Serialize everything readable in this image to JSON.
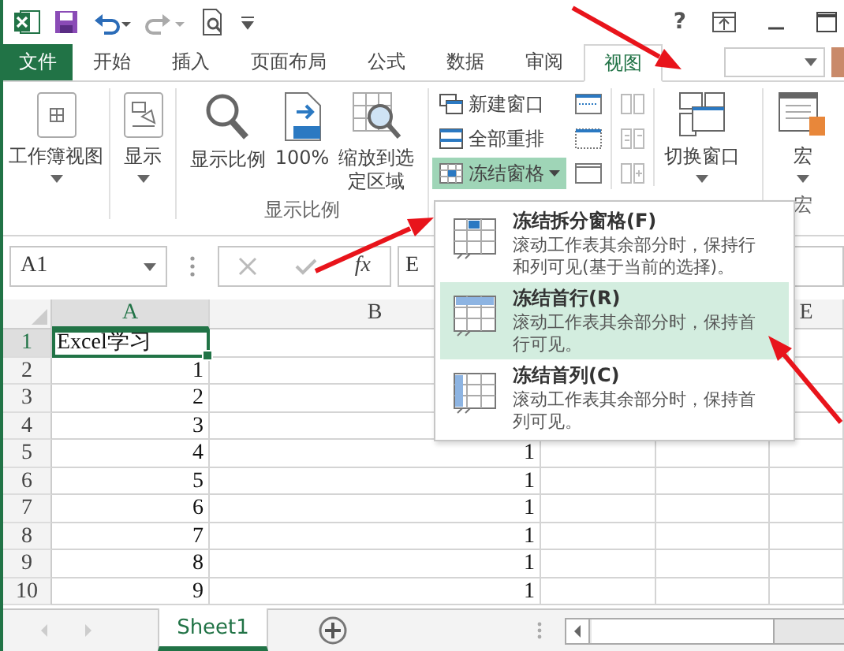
{
  "title_bar": {
    "help": "?"
  },
  "tabs": [
    {
      "label": "文件",
      "kind": "file",
      "selected": false
    },
    {
      "label": "开始",
      "kind": "tab",
      "selected": false
    },
    {
      "label": "插入",
      "kind": "tab",
      "selected": false
    },
    {
      "label": "页面布局",
      "kind": "tab",
      "selected": false
    },
    {
      "label": "公式",
      "kind": "tab",
      "selected": false
    },
    {
      "label": "数据",
      "kind": "tab",
      "selected": false
    },
    {
      "label": "审阅",
      "kind": "tab",
      "selected": false
    },
    {
      "label": "视图",
      "kind": "tab",
      "selected": true
    }
  ],
  "ribbon": {
    "workbook_views": "工作簿视图",
    "show": "显示",
    "zoom_group": {
      "label": "显示比例",
      "buttons": [
        "显示比例",
        "100%",
        "缩放到选定区域"
      ]
    },
    "window_group": {
      "buttons": [
        {
          "label": "新建窗口",
          "selected": false
        },
        {
          "label": "全部重排",
          "selected": false
        },
        {
          "label": "冻结窗格",
          "selected": true
        }
      ],
      "switch_windows": "切换窗口"
    },
    "macro_group": {
      "button": "宏",
      "label": "宏"
    }
  },
  "formula_bar": {
    "name_box": "A1",
    "function_button": "fx",
    "value": "E"
  },
  "freeze_menu": [
    {
      "title": "冻结拆分窗格(F)",
      "description": "滚动工作表其余部分时，保持行和列可见(基于当前的选择)。",
      "selected": false
    },
    {
      "title": "冻结首行(R)",
      "description": "滚动工作表其余部分时，保持首行可见。",
      "selected": true
    },
    {
      "title": "冻结首列(C)",
      "description": "滚动工作表其余部分时，保持首列可见。",
      "selected": false
    }
  ],
  "columns": [
    {
      "label": "A",
      "selected": true
    },
    {
      "label": "B",
      "selected": false
    },
    {
      "label": "E",
      "selected": false
    }
  ],
  "rows": [
    {
      "num": "1",
      "selected": true,
      "a": "Excel学习"
    },
    {
      "num": "2",
      "selected": false,
      "a": "1"
    },
    {
      "num": "3",
      "selected": false,
      "a": "2"
    },
    {
      "num": "4",
      "selected": false,
      "a": "3"
    },
    {
      "num": "5",
      "selected": false,
      "a": "4",
      "b": "1"
    },
    {
      "num": "6",
      "selected": false,
      "a": "5",
      "b": "1"
    },
    {
      "num": "7",
      "selected": false,
      "a": "6",
      "b": "1"
    },
    {
      "num": "8",
      "selected": false,
      "a": "7",
      "b": "1"
    },
    {
      "num": "9",
      "selected": false,
      "a": "8",
      "b": "1"
    },
    {
      "num": "10",
      "selected": false,
      "a": "9",
      "b": "1"
    }
  ],
  "sheet_tabs": [
    {
      "label": "Sheet1",
      "selected": true
    }
  ]
}
